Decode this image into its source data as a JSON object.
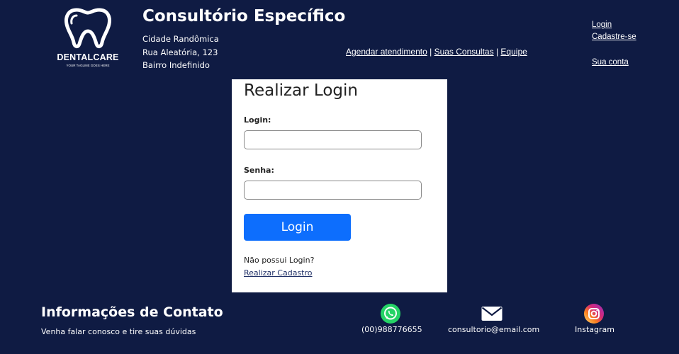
{
  "logo": {
    "name": "DENTALCARE",
    "tagline": "YOUR TAGLINE GOES HERE"
  },
  "header": {
    "title": "Consultório Específico",
    "address": [
      "Cidade Randômica",
      "Rua Aleatória, 123",
      "Bairro Indefinido"
    ],
    "nav": {
      "agendar": "Agendar atendimento",
      "consultas": "Suas Consultas",
      "equipe": "Equipe",
      "separator": "|"
    },
    "account": {
      "login": "Login",
      "cadastro": "Cadastre-se",
      "sua_conta": "Sua conta"
    }
  },
  "login_form": {
    "title": "Realizar Login",
    "login_label": "Login:",
    "login_value": "",
    "senha_label": "Senha:",
    "senha_value": "",
    "submit_label": "Login",
    "no_account_text": "Não possui Login?",
    "register_link": "Realizar Cadastro"
  },
  "footer": {
    "title": "Informações de Contato",
    "subtitle": "Venha falar conosco e tire suas dúvidas",
    "contacts": {
      "phone": "(00)988776655",
      "email": "consultorio@email.com",
      "instagram": "Instagram"
    },
    "icons": [
      "whatsapp-icon",
      "email-icon",
      "instagram-icon",
      "tooth-icon"
    ]
  },
  "colors": {
    "background": "#0f1b43",
    "card": "#ffffff",
    "button": "#0d6efd",
    "whatsapp": "#25d366"
  }
}
